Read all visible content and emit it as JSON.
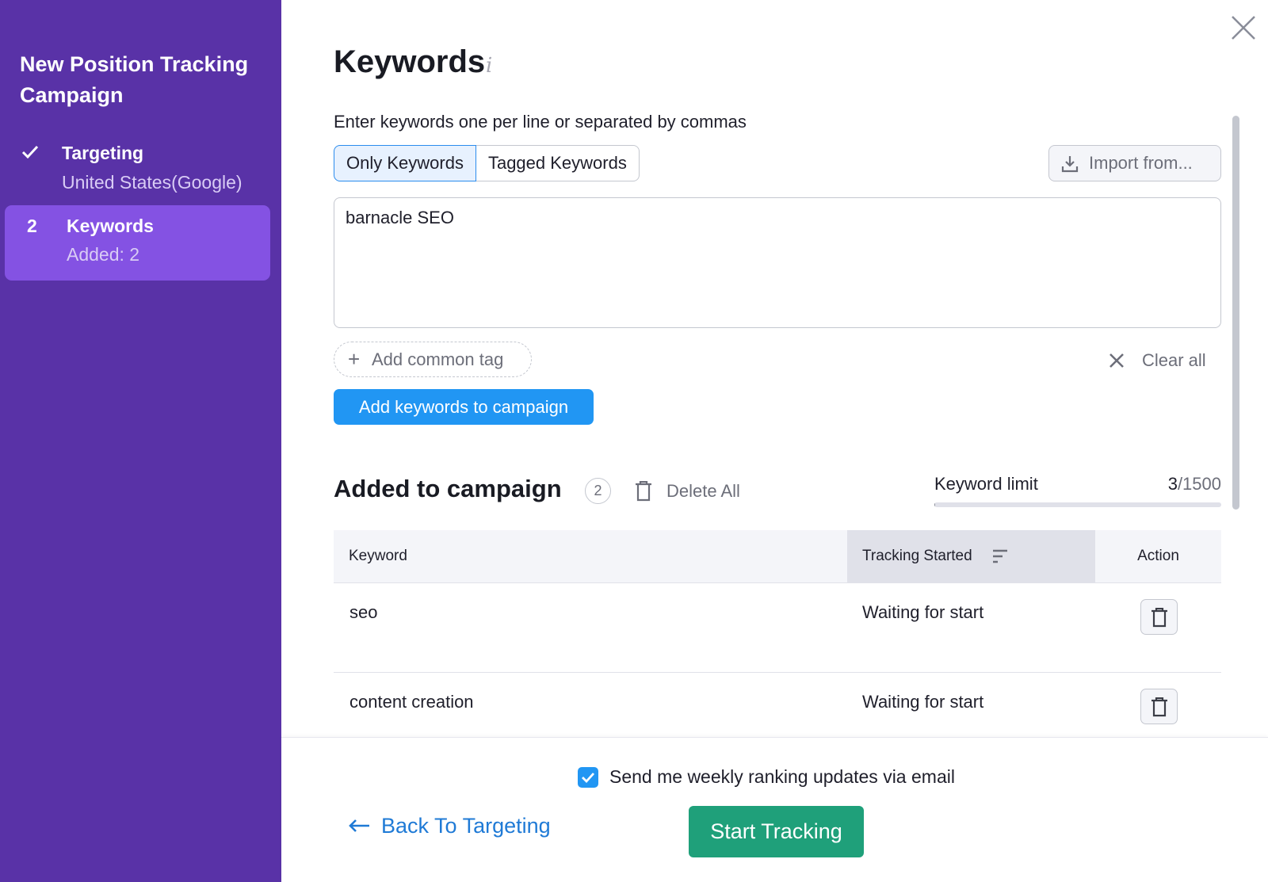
{
  "sidebar": {
    "title": "New Position Tracking Campaign",
    "steps": [
      {
        "label": "Targeting",
        "sub": "United States(Google)",
        "status": "done",
        "icon": "check-icon"
      },
      {
        "label": "Keywords",
        "sub": "Added: 2",
        "status": "active",
        "number": "2"
      }
    ]
  },
  "header": {
    "title": "Keywords",
    "info_icon": "i",
    "hint": "Enter keywords one per line or separated by commas"
  },
  "mode_tabs": [
    {
      "label": "Only Keywords",
      "selected": true
    },
    {
      "label": "Tagged Keywords",
      "selected": false
    }
  ],
  "import_label": "Import from...",
  "keywords_input": {
    "value": "barnacle SEO"
  },
  "add_tag_label": "Add common tag",
  "clear_all_label": "Clear all",
  "add_keywords_label": "Add keywords to campaign",
  "added": {
    "title": "Added to campaign",
    "count": "2",
    "delete_all_label": "Delete All"
  },
  "keyword_limit": {
    "label": "Keyword limit",
    "used": "3",
    "total": "/1500",
    "fraction": 0.002
  },
  "table": {
    "columns": [
      "Keyword",
      "Tracking Started",
      "Action"
    ],
    "rows": [
      {
        "keyword": "seo",
        "status": "Waiting for start"
      },
      {
        "keyword": "content creation",
        "status": "Waiting for start"
      }
    ]
  },
  "footer": {
    "email_label": "Send me weekly ranking updates via email",
    "email_checked": true,
    "back_label": "Back To Targeting",
    "start_label": "Start Tracking"
  },
  "colors": {
    "sidebar": "#5932a7",
    "active_step": "#8452e3",
    "primary_blue": "#2196f3",
    "start_green": "#1fa07a",
    "link_blue": "#1f7ad6"
  }
}
